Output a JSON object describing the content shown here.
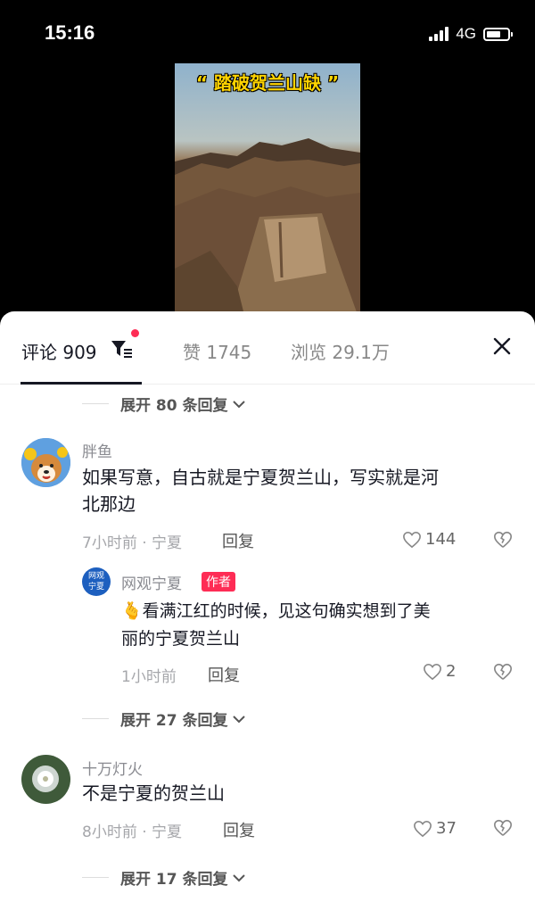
{
  "status_bar": {
    "time": "15:16",
    "network": "4G"
  },
  "video": {
    "title": "“ 踏破贺兰山缺 ”"
  },
  "tabs": {
    "comments_label": "评论 909",
    "likes_label": "赞 1745",
    "views_label": "浏览 29.1万"
  },
  "colors": {
    "accent": "#fe2c55",
    "text": "#161823",
    "muted": "#8a8b91"
  },
  "comments": [
    {
      "expand_label": "展开 80 条回复",
      "username": "胖鱼",
      "text_line1": "如果写意，自古就是宁夏贺兰山，写实就是河",
      "text_line2": "北那边",
      "meta": "7小时前 · 宁夏",
      "reply_label": "回复",
      "likes": "144"
    },
    {
      "username": "网观宁夏",
      "badge": "作者",
      "avatar_text_1": "网观",
      "avatar_text_2": "宁夏",
      "emoji": "🫰",
      "text_line1": "看满江红的时候，见这句确实想到了美",
      "text_line2": "丽的宁夏贺兰山",
      "meta": "1小时前",
      "reply_label": "回复",
      "likes": "2"
    },
    {
      "expand_label": "展开 27 条回复",
      "username": "十万灯火",
      "text_line1": "不是宁夏的贺兰山",
      "meta": "8小时前 · 宁夏",
      "reply_label": "回复",
      "likes": "37"
    }
  ],
  "bottom_expand_label": "展开 17 条回复"
}
